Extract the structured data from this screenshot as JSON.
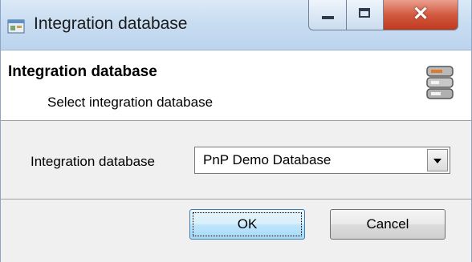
{
  "window": {
    "title": "Integration database"
  },
  "header": {
    "title": "Integration database",
    "subtitle": "Select integration database"
  },
  "form": {
    "label": "Integration database",
    "selected": "PnP Demo Database"
  },
  "buttons": {
    "ok": "OK",
    "cancel": "Cancel"
  },
  "icons": {
    "app": "window-app-icon",
    "header": "database-icon",
    "dropdown": "dropdown-arrow-icon"
  },
  "colors": {
    "titlebar": "#c9ddf1",
    "close": "#c0391f",
    "accent_focus": "#3c7fb1"
  }
}
